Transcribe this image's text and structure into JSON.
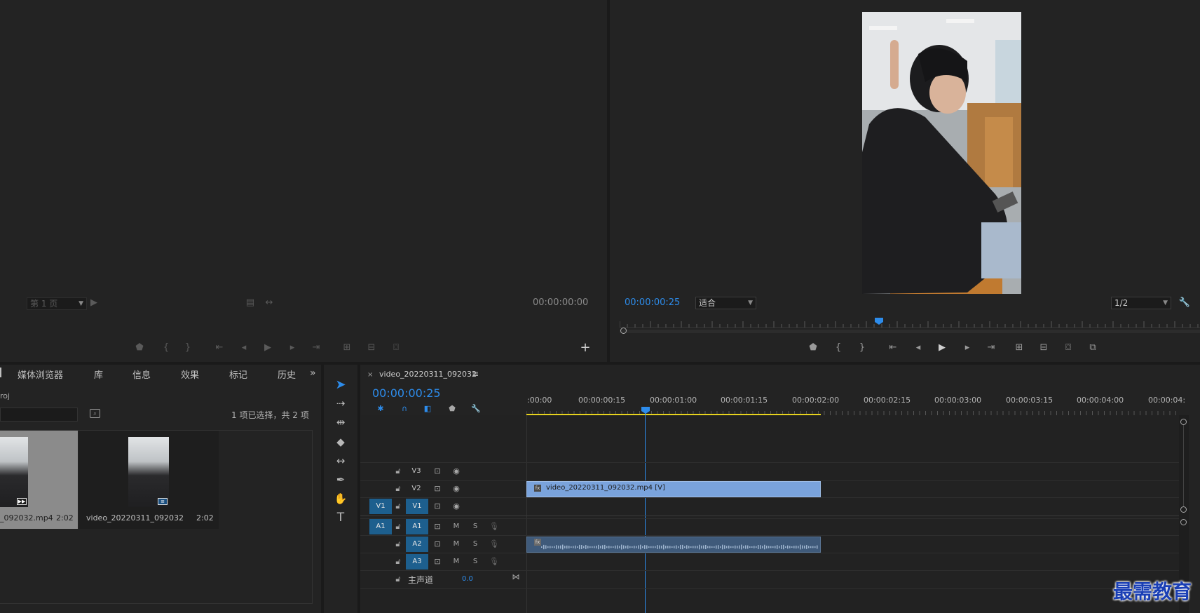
{
  "source_monitor": {
    "page_selector": "第 1 页",
    "timecode": "00:00:00:00"
  },
  "program_monitor": {
    "timecode": "00:00:00:25",
    "fit_option": "适合",
    "resolution": "1/2"
  },
  "project_panel": {
    "tabs": [
      "媒体浏览器",
      "库",
      "信息",
      "效果",
      "标记",
      "历史"
    ],
    "project_name_partial": "roj",
    "selection_status": "1 项已选择，共 2 项",
    "items": [
      {
        "name": "_092032.mp4",
        "duration": "2:02"
      },
      {
        "name": "video_20220311_092032",
        "duration": "2:02"
      }
    ]
  },
  "timeline": {
    "sequence_name": "video_20220311_092032",
    "timecode": "00:00:00:25",
    "ruler_labels": [
      ":00:00",
      "00:00:00:15",
      "00:00:01:00",
      "00:00:01:15",
      "00:00:02:00",
      "00:00:02:15",
      "00:00:03:00",
      "00:00:03:15",
      "00:00:04:00",
      "00:00:04:"
    ],
    "tracks": {
      "v3": "V3",
      "v2": "V2",
      "v1": "V1",
      "v1_src": "V1",
      "a1": "A1",
      "a1_src": "A1",
      "a2": "A2",
      "a3": "A3",
      "mute": "M",
      "solo": "S"
    },
    "master_label": "主声道",
    "master_value": "0.0",
    "video_clip_label": "video_20220311_092032.mp4 [V]"
  },
  "watermark": "最需教育",
  "colors": {
    "accent_blue": "#2d8ceb",
    "video_clip": "#7aa3dc",
    "audio_clip": "#3f5a7a",
    "work_area": "#e6d21d"
  }
}
